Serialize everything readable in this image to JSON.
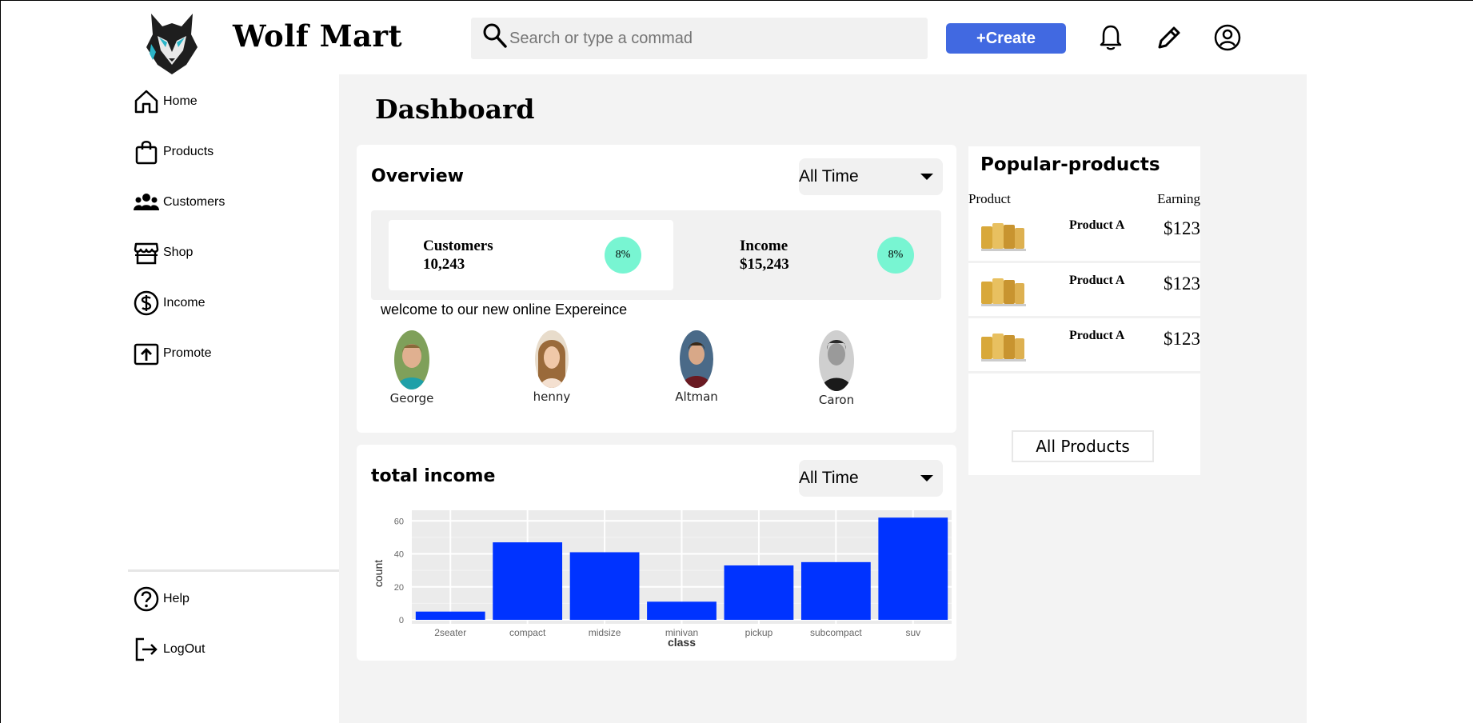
{
  "app": {
    "brand": "Wolf Mart"
  },
  "search": {
    "placeholder": "Search or type a commad",
    "value": ""
  },
  "header": {
    "create_label": "+Create"
  },
  "sidebar": {
    "items": [
      {
        "label": "Home",
        "icon": "home-icon"
      },
      {
        "label": "Products",
        "icon": "shopping-bag-icon"
      },
      {
        "label": "Customers",
        "icon": "users-icon"
      },
      {
        "label": "Shop",
        "icon": "store-icon"
      },
      {
        "label": "Income",
        "icon": "dollar-circle-icon"
      },
      {
        "label": "Promote",
        "icon": "upload-box-icon"
      }
    ],
    "bottom": [
      {
        "label": "Help",
        "icon": "help-circle-icon"
      },
      {
        "label": "LogOut",
        "icon": "logout-icon"
      }
    ]
  },
  "main": {
    "title": "Dashboard",
    "overview": {
      "title": "Overview",
      "filter": "All Time",
      "stats": [
        {
          "label": "Customers",
          "value": "10,243",
          "change": "8%"
        },
        {
          "label": "Income",
          "value": "$15,243",
          "change": "8%"
        }
      ],
      "welcome": "welcome to our new online Expereince",
      "people": [
        "George",
        "henny",
        "Altman",
        "Caron"
      ]
    },
    "income": {
      "title": "total income",
      "filter": "All Time"
    }
  },
  "popular": {
    "title": "Popular-products",
    "col_product": "Product",
    "col_earning": "Earning",
    "rows": [
      {
        "name": "Product A",
        "earning": "$123"
      },
      {
        "name": "Product A",
        "earning": "$123"
      },
      {
        "name": "Product A",
        "earning": "$123"
      }
    ],
    "all_label": "All Products"
  },
  "colors": {
    "accent": "#4169e1",
    "badge": "#78f5d2",
    "bar": "#0033ff"
  },
  "chart_data": {
    "type": "bar",
    "categories": [
      "2seater",
      "compact",
      "midsize",
      "minivan",
      "pickup",
      "subcompact",
      "suv"
    ],
    "values": [
      5,
      47,
      41,
      11,
      33,
      35,
      62
    ],
    "xlabel": "class",
    "ylabel": "count",
    "yticks": [
      0,
      20,
      40,
      60
    ],
    "ylim": [
      0,
      65
    ],
    "grid": true
  }
}
